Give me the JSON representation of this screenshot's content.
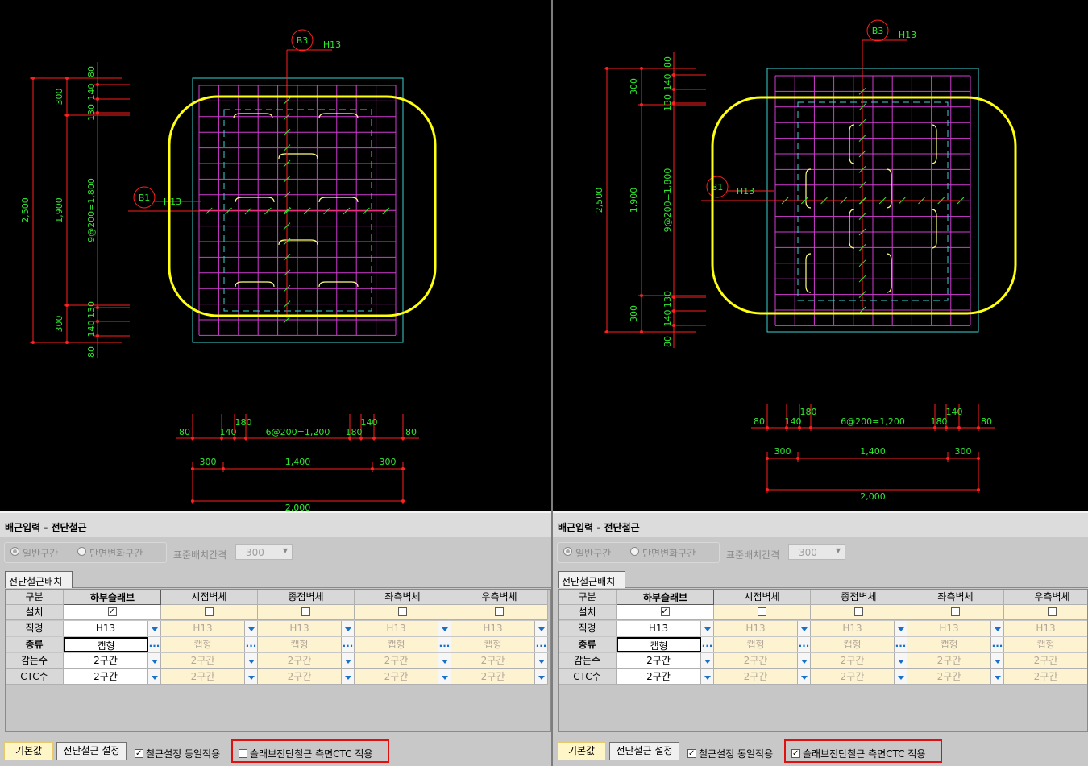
{
  "left": {
    "cad": {
      "labels": {
        "b3": "B3",
        "b3_bar": "H13",
        "b1": "B1",
        "b1_bar": "H13",
        "dim_total_v": "2,500",
        "dim_mid_v": "1,900",
        "dim_top_v": "300",
        "dim_bot_v": "300",
        "dim_spacing_v": "9@200=1,800",
        "dim_80a": "80",
        "dim_140a": "140",
        "dim_130a": "130",
        "dim_130b": "130",
        "dim_140b": "140",
        "dim_80b": "80",
        "h_80a": "80",
        "h_140a": "140",
        "h_180a": "180",
        "h_spacing": "6@200=1,200",
        "h_180b": "180",
        "h_140b": "140",
        "h_80b": "80",
        "h_300a": "300",
        "h_1400": "1,400",
        "h_300b": "300",
        "h_2000": "2,000"
      }
    },
    "panel": {
      "title": "배근입력 - 전단철근",
      "radio_general": "일반구간",
      "radio_section": "단면변화구간",
      "std_label": "표준배치간격",
      "std_value": "300",
      "tab": "전단철근배치",
      "headers": [
        "구분",
        "하부슬래브",
        "시점벽체",
        "종점벽체",
        "좌측벽체",
        "우측벽체"
      ],
      "row_labels": [
        "설치",
        "직경",
        "종류",
        "감는수",
        "CTC수"
      ],
      "install": [
        true,
        false,
        false,
        false,
        false
      ],
      "diameter": [
        "H13",
        "H13",
        "H13",
        "H13",
        "H13"
      ],
      "type": [
        "캡형",
        "캡형",
        "캡형",
        "캡형",
        "캡형"
      ],
      "wraps": [
        "2구간",
        "2구간",
        "2구간",
        "2구간",
        "2구간"
      ],
      "ctc": [
        "2구간",
        "2구간",
        "2구간",
        "2구간",
        "2구간"
      ],
      "btn_default": "기본값",
      "btn_setting": "전단철근 설정",
      "chk_same": "철근설정 동일적용",
      "chk_same_checked": true,
      "chk_ctc": "슬래브전단철근 측면CTC 적용",
      "chk_ctc_checked": false
    }
  },
  "right": {
    "cad": {
      "labels": {
        "b3": "B3",
        "b3_bar": "H13",
        "b1": "B1",
        "b1_bar": "H13",
        "dim_total_v": "2,500",
        "dim_mid_v": "1,900",
        "dim_top_v": "300",
        "dim_bot_v": "300",
        "dim_spacing_v": "9@200=1,800",
        "dim_80a": "80",
        "dim_140a": "140",
        "dim_130a": "130",
        "dim_130b": "130",
        "dim_140b": "140",
        "dim_80b": "80",
        "h_80a": "80",
        "h_140a": "140",
        "h_180a": "180",
        "h_spacing": "6@200=1,200",
        "h_180b": "180",
        "h_140b": "140",
        "h_80b": "80",
        "h_300a": "300",
        "h_1400": "1,400",
        "h_300b": "300",
        "h_2000": "2,000"
      }
    },
    "panel": {
      "title": "배근입력 - 전단철근",
      "radio_general": "일반구간",
      "radio_section": "단면변화구간",
      "std_label": "표준배치간격",
      "std_value": "300",
      "tab": "전단철근배치",
      "headers": [
        "구분",
        "하부슬래브",
        "시점벽체",
        "종점벽체",
        "좌측벽체",
        "우측벽체"
      ],
      "row_labels": [
        "설치",
        "직경",
        "종류",
        "감는수",
        "CTC수"
      ],
      "install": [
        true,
        false,
        false,
        false,
        false
      ],
      "diameter": [
        "H13",
        "H13",
        "H13",
        "H13",
        "H13"
      ],
      "type": [
        "캡형",
        "캡형",
        "캡형",
        "캡형",
        "캡형"
      ],
      "wraps": [
        "2구간",
        "2구간",
        "2구간",
        "2구간",
        "2구간"
      ],
      "ctc": [
        "2구간",
        "2구간",
        "2구간",
        "2구간",
        "2구간"
      ],
      "btn_default": "기본값",
      "btn_setting": "전단철근 설정",
      "chk_same": "철근설정 동일적용",
      "chk_same_checked": true,
      "chk_ctc": "슬래브전단철근 측면CTC 적용",
      "chk_ctc_checked": true
    }
  },
  "colors": {
    "cad_bg": "#000000",
    "dim_red": "#ff2020",
    "text_green": "#2ee82e",
    "grid_magenta": "#d23cd2",
    "outline_cyan": "#3cd2d2",
    "highlight_yellow": "#ffff10",
    "callout_red": "#e01010"
  }
}
